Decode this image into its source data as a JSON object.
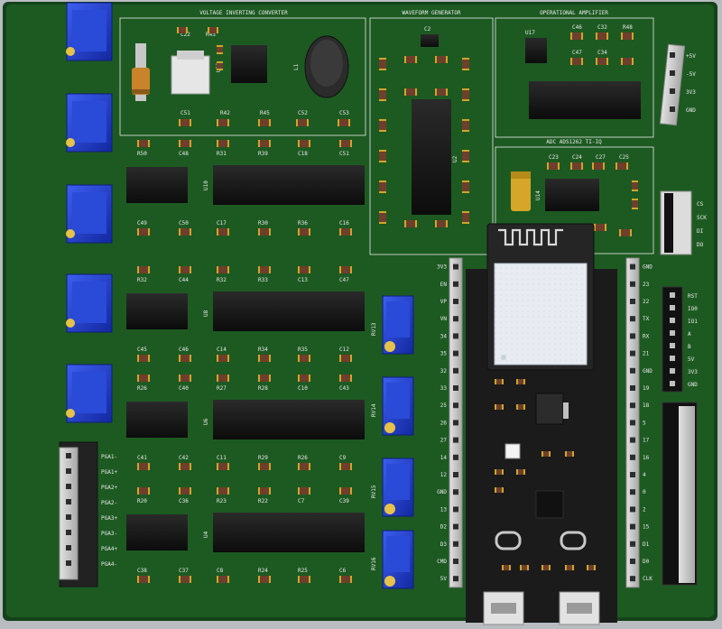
{
  "view": {
    "kind": "3D PCB render"
  },
  "colors": {
    "pcb": "#1d5a22",
    "pcb_edge": "#14421a",
    "silkscreen": "#e9e9e9",
    "gold": "#d6ad2a",
    "potentiometer": "#1f3fc4",
    "ic_body": "#151515",
    "esp_module": "#202020",
    "esp_shield": "#e8ecf2",
    "header_plastic": "#c9c9c9"
  },
  "sections": {
    "voltage_inverter": "VOLTAGE INVERTING CONVERTER",
    "waveform_generator": "WAVEFORM GENERATOR",
    "op_amp": "OPERATIONAL AMPLIFIER",
    "adc": "ADC ADS1262 TI-IQ"
  },
  "power_header": {
    "pins": [
      "+5V",
      "-5V",
      "3V3",
      "GND"
    ]
  },
  "sd_header": {
    "pins": [
      "CS",
      "SCK",
      "DI",
      "DO"
    ]
  },
  "left_header": {
    "pins": [
      "PGA1-",
      "PGA1+",
      "PGA2+",
      "PGA2-",
      "PGA3+",
      "PGA3-",
      "PGA4+",
      "PGA4-"
    ]
  },
  "right_header": {
    "pins": [
      "RST",
      "IO0",
      "IO1",
      "A",
      "B",
      "5V",
      "3V3",
      "GND"
    ]
  },
  "esp_left_pins": [
    "3V3",
    "EN",
    "VP",
    "VN",
    "34",
    "35",
    "32",
    "33",
    "25",
    "26",
    "27",
    "14",
    "12",
    "GND",
    "13",
    "D2",
    "D3",
    "CMD",
    "5V"
  ],
  "esp_right_pins": [
    "GND",
    "23",
    "22",
    "TX",
    "RX",
    "21",
    "GND",
    "19",
    "18",
    "5",
    "17",
    "16",
    "4",
    "0",
    "2",
    "15",
    "D1",
    "D0",
    "CLK"
  ],
  "pot_labels": [
    "RV13",
    "RV14",
    "RV15",
    "RV16"
  ],
  "refs": {
    "op_amp_chip": "U17",
    "adc_chip": "U14",
    "inductor": "L1",
    "cap_c22": "C22",
    "r43": "R43",
    "r44": "R44",
    "c51": "C51",
    "r42": "R42",
    "c52": "C52",
    "r45": "R45",
    "u12": "U12",
    "c53": "C53",
    "c50": "C50",
    "row1": [
      "R50",
      "C48",
      "R31",
      "R39",
      "C18",
      "C51"
    ],
    "u9": "U9",
    "u10": "U10",
    "row2": [
      "C49",
      "C50",
      "C17",
      "R30",
      "R36",
      "C16"
    ],
    "row3": [
      "R32",
      "C44",
      "R32",
      "R33",
      "C13",
      "C47"
    ],
    "u7": "U7",
    "u8": "U8",
    "row4": [
      "C45",
      "C46",
      "C14",
      "R34",
      "R35",
      "C12"
    ],
    "row5": [
      "R26",
      "C40",
      "R27",
      "R28",
      "C10",
      "C43"
    ],
    "u5": "U5",
    "u6": "U6",
    "row6": [
      "C41",
      "C42",
      "C11",
      "R29",
      "R26",
      "C9"
    ],
    "row7": [
      "R20",
      "C36",
      "R23",
      "R22",
      "C7",
      "C39"
    ],
    "u3": "U3",
    "u4": "U4",
    "row8": [
      "C38",
      "C37",
      "C8",
      "R24",
      "R25",
      "C6"
    ],
    "wave_chip": "U2",
    "wave_top": "C2",
    "op_caps": [
      "C46",
      "C32",
      "C47",
      "C34",
      "R48"
    ],
    "adc_caps": [
      "C23",
      "C24",
      "C27",
      "C25"
    ]
  }
}
